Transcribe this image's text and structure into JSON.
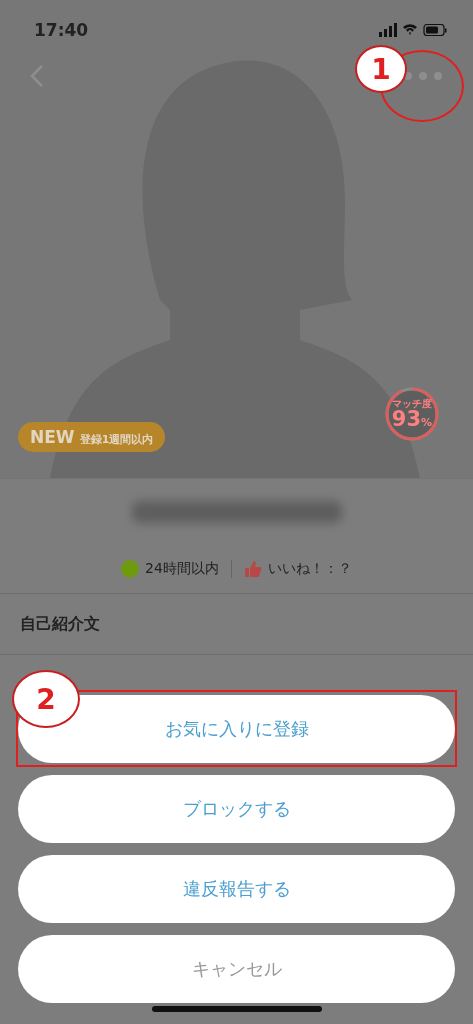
{
  "status_bar": {
    "time": "17:40"
  },
  "profile": {
    "badge": {
      "label": "NEW",
      "sublabel": "登録1週間以内"
    },
    "match": {
      "label": "マッチ度",
      "value": "93",
      "unit": "%",
      "level": 0.93
    },
    "online_status": {
      "label": "24時間以内",
      "color": "#6e9a10"
    },
    "likes": {
      "label": "いいね！：？"
    }
  },
  "sections": [
    {
      "title": "自己紹介文"
    }
  ],
  "action_sheet": {
    "buttons": [
      {
        "label": "お気に入りに登録",
        "kind": "action"
      },
      {
        "label": "ブロックする",
        "kind": "action"
      },
      {
        "label": "違反報告する",
        "kind": "action"
      },
      {
        "label": "キャンセル",
        "kind": "cancel"
      }
    ]
  },
  "annotations": [
    {
      "number": "1",
      "kind": "ellipse"
    },
    {
      "number": "2",
      "kind": "box"
    }
  ]
}
